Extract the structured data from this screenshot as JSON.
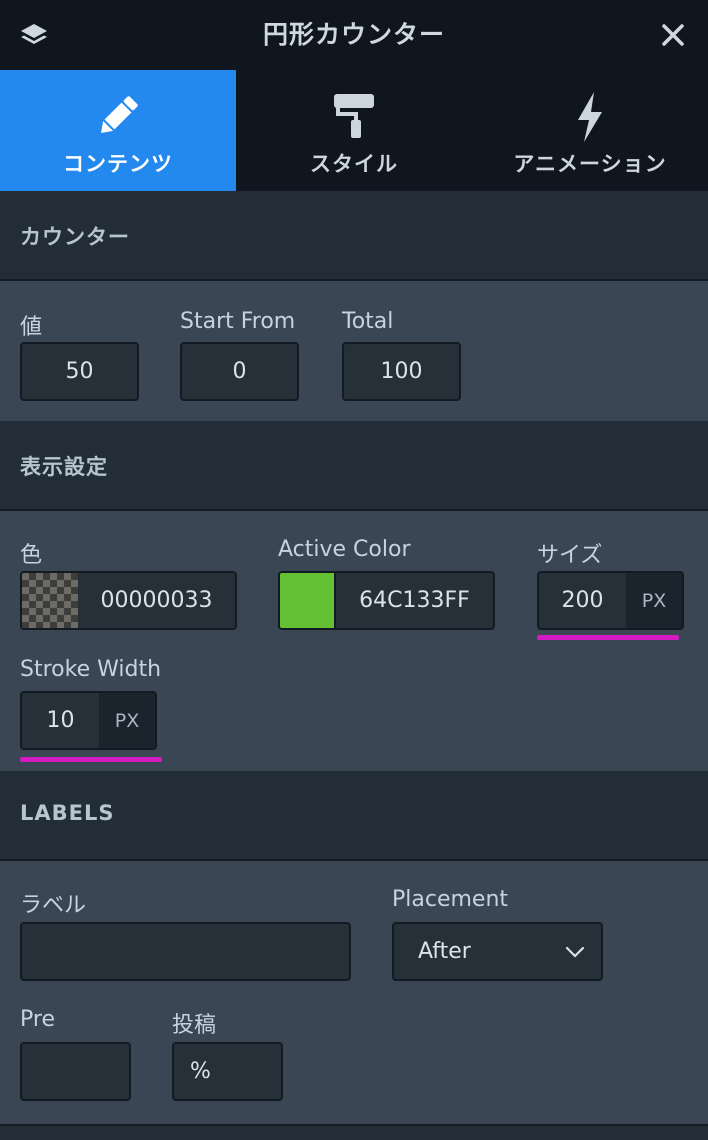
{
  "header": {
    "title": "円形カウンター",
    "layers_icon": "layers-icon",
    "close_icon": "close-icon"
  },
  "tabs": [
    {
      "label": "コンテンツ",
      "icon": "pencil-icon",
      "active": true
    },
    {
      "label": "スタイル",
      "icon": "paint-roller-icon",
      "active": false
    },
    {
      "label": "アニメーション",
      "icon": "lightning-icon",
      "active": false
    }
  ],
  "counter_section": {
    "title": "カウンター",
    "value_label": "値",
    "value": "50",
    "start_label": "Start From",
    "start_value": "0",
    "total_label": "Total",
    "total_value": "100"
  },
  "display_section": {
    "title": "表示設定",
    "color_label": "色",
    "color_value": "00000033",
    "active_color_label": "Active Color",
    "active_color_value": "64C133FF",
    "active_color_swatch": "#64c133",
    "size_label": "サイズ",
    "size_value": "200",
    "size_unit": "PX",
    "stroke_label": "Stroke Width",
    "stroke_value": "10",
    "stroke_unit": "PX",
    "highlight_color": "#d31bc1"
  },
  "labels_section": {
    "title": "LABELS",
    "label_label": "ラベル",
    "label_value": "",
    "placement_label": "Placement",
    "placement_value": "After",
    "pre_label": "Pre",
    "pre_value": "",
    "post_label": "投稿",
    "post_value": "%"
  }
}
